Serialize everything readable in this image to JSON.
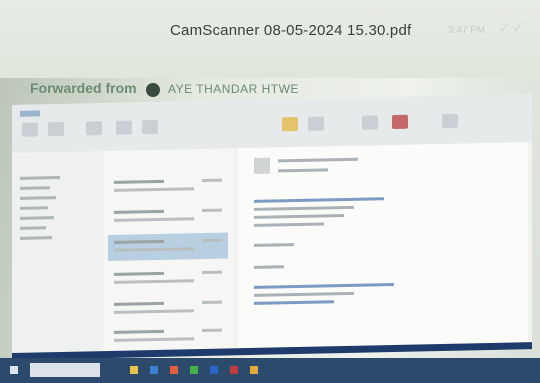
{
  "bubble": {
    "filename": "CamScanner 08-05-2024 15.30.pdf",
    "time": "3:47 PM",
    "checks": "✓✓"
  },
  "forward": {
    "label": "Forwarded from",
    "name": "AYE THANDAR HTWE"
  },
  "colors": {
    "taskbar": "#2c4a6b",
    "ribbon": "#e6eaea",
    "selected_row": "#b7cfe0"
  },
  "icons": [
    "channel-avatar-icon",
    "windows-start-icon",
    "taskbar-app-icon"
  ]
}
